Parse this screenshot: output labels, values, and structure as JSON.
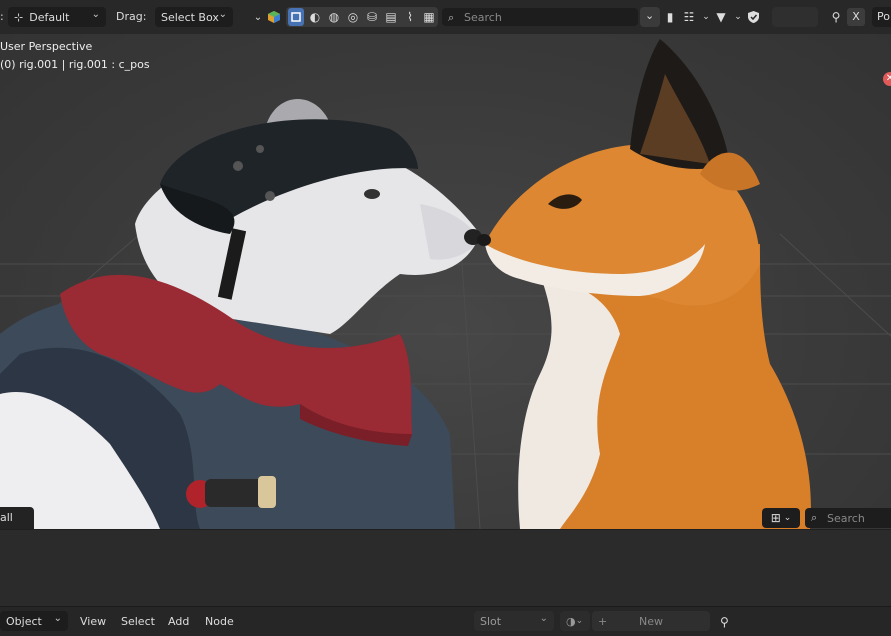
{
  "topbar": {
    "orientation_label": "Default",
    "drag_label": "Drag:",
    "drag_value": "Select Box",
    "search_placeholder": "Search",
    "x_label": "X",
    "po_label": "Po"
  },
  "viewport": {
    "view_name": "User Perspective",
    "object_info": "(0) rig.001 | rig.001 : c_pos",
    "all_label": "all",
    "search_placeholder": "Search"
  },
  "bottombar": {
    "mode": "Object",
    "menus": [
      "View",
      "Select",
      "Add",
      "Node"
    ],
    "slot": "Slot",
    "new_label": "New"
  },
  "icons": [
    "orientation-gizmo-icon",
    "chevron-down-icon",
    "color-cube-icon",
    "select-box-icon",
    "sphere-icon",
    "paint-icon",
    "globe-icon",
    "bucket-icon",
    "gradient-icon",
    "smear-icon",
    "fill-icon",
    "search-icon",
    "filter-icon",
    "shield-icon",
    "bookmark-icon",
    "hierarchy-icon",
    "pin-icon",
    "grid-layout-icon",
    "material-sphere-icon",
    "plus-icon"
  ],
  "colors": {
    "accent": "#4772b3",
    "close_badge": "#e05a5a"
  }
}
